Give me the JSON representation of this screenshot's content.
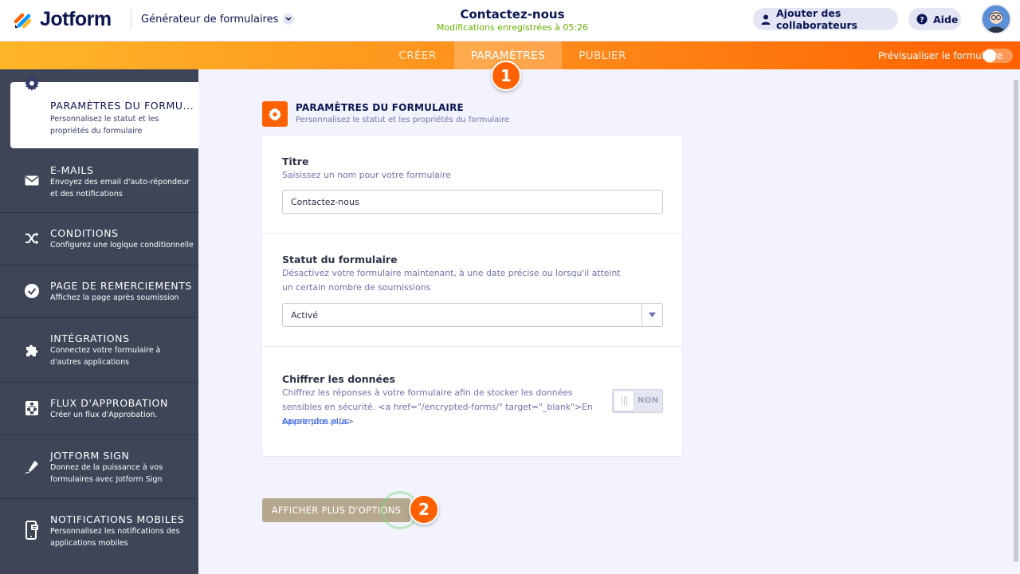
{
  "header": {
    "logo_text": "Jotform",
    "builder_label": "Générateur de formulaires",
    "form_title": "Contactez-nous",
    "save_status": "Modifications enregistrées à 05:26",
    "collaborators_label": "Ajouter des collaborateurs",
    "help_label": "Aide"
  },
  "nav": {
    "tabs": [
      {
        "label": "CRÉER",
        "active": false
      },
      {
        "label": "PARAMÈTRES",
        "active": true
      },
      {
        "label": "PUBLIER",
        "active": false
      }
    ],
    "preview_label": "Prévisualiser le formulaire",
    "preview_on": false
  },
  "badges": [
    "1",
    "2"
  ],
  "sidebar": {
    "items": [
      {
        "title": "PARAMÈTRES DU FORMU...",
        "desc": "Personnalisez le statut et les propriétés du formulaire",
        "icon": "gear-icon",
        "active": true
      },
      {
        "title": "E-MAILS",
        "desc": "Envoyez des email d'auto-répondeur et des notifications",
        "icon": "envelope-icon",
        "active": false
      },
      {
        "title": "CONDITIONS",
        "desc": "Configurez une logique conditionnelle",
        "icon": "shuffle-icon",
        "active": false
      },
      {
        "title": "PAGE DE REMERCIEMENTS",
        "desc": "Affichez la page après soumission",
        "icon": "check-circle-icon",
        "active": false
      },
      {
        "title": "INTÉGRATIONS",
        "desc": "Connectez votre formulaire à d'autres applications",
        "icon": "puzzle-icon",
        "active": false
      },
      {
        "title": "FLUX D'APPROBATION",
        "desc": "Créer un flux d'Approbation.",
        "icon": "flow-icon",
        "active": false
      },
      {
        "title": "JOTFORM SIGN",
        "desc": "Donnez de la puissance à vos formulaires avec Jotform Sign",
        "icon": "pen-icon",
        "active": false
      },
      {
        "title": "NOTIFICATIONS MOBILES",
        "desc": "Personnalisez les notifications des applications mobiles",
        "icon": "mobile-icon",
        "active": false
      }
    ]
  },
  "main": {
    "section_title": "PARAMÈTRES DU FORMULAIRE",
    "section_sub": "Personnalisez le statut et les propriétés du formulaire",
    "title_field": {
      "label": "Titre",
      "desc": "Saisissez un nom pour votre formulaire",
      "value": "Contactez-nous"
    },
    "status_field": {
      "label": "Statut du formulaire",
      "desc": "Désactivez votre formulaire maintenant, à une date précise ou lorsqu'il atteint un certain nombre de soumissions",
      "value": "Activé"
    },
    "encrypt_field": {
      "label": "Chiffrer les données",
      "desc": "Chiffrez les réponses à votre formulaire afin de stocker les données sensibles en sécurité. <a href=\"/encrypted-forms/\" target=\"_blank\">En savoir plus.</a>",
      "link": "Apprendre plus",
      "toggle_label": "NON"
    },
    "more_button": "AFFICHER PLUS D'OPTIONS"
  },
  "colors": {
    "accent": "#ff6100",
    "navy": "#0a1551",
    "sidebar": "#3e4556",
    "success": "#64b200"
  }
}
